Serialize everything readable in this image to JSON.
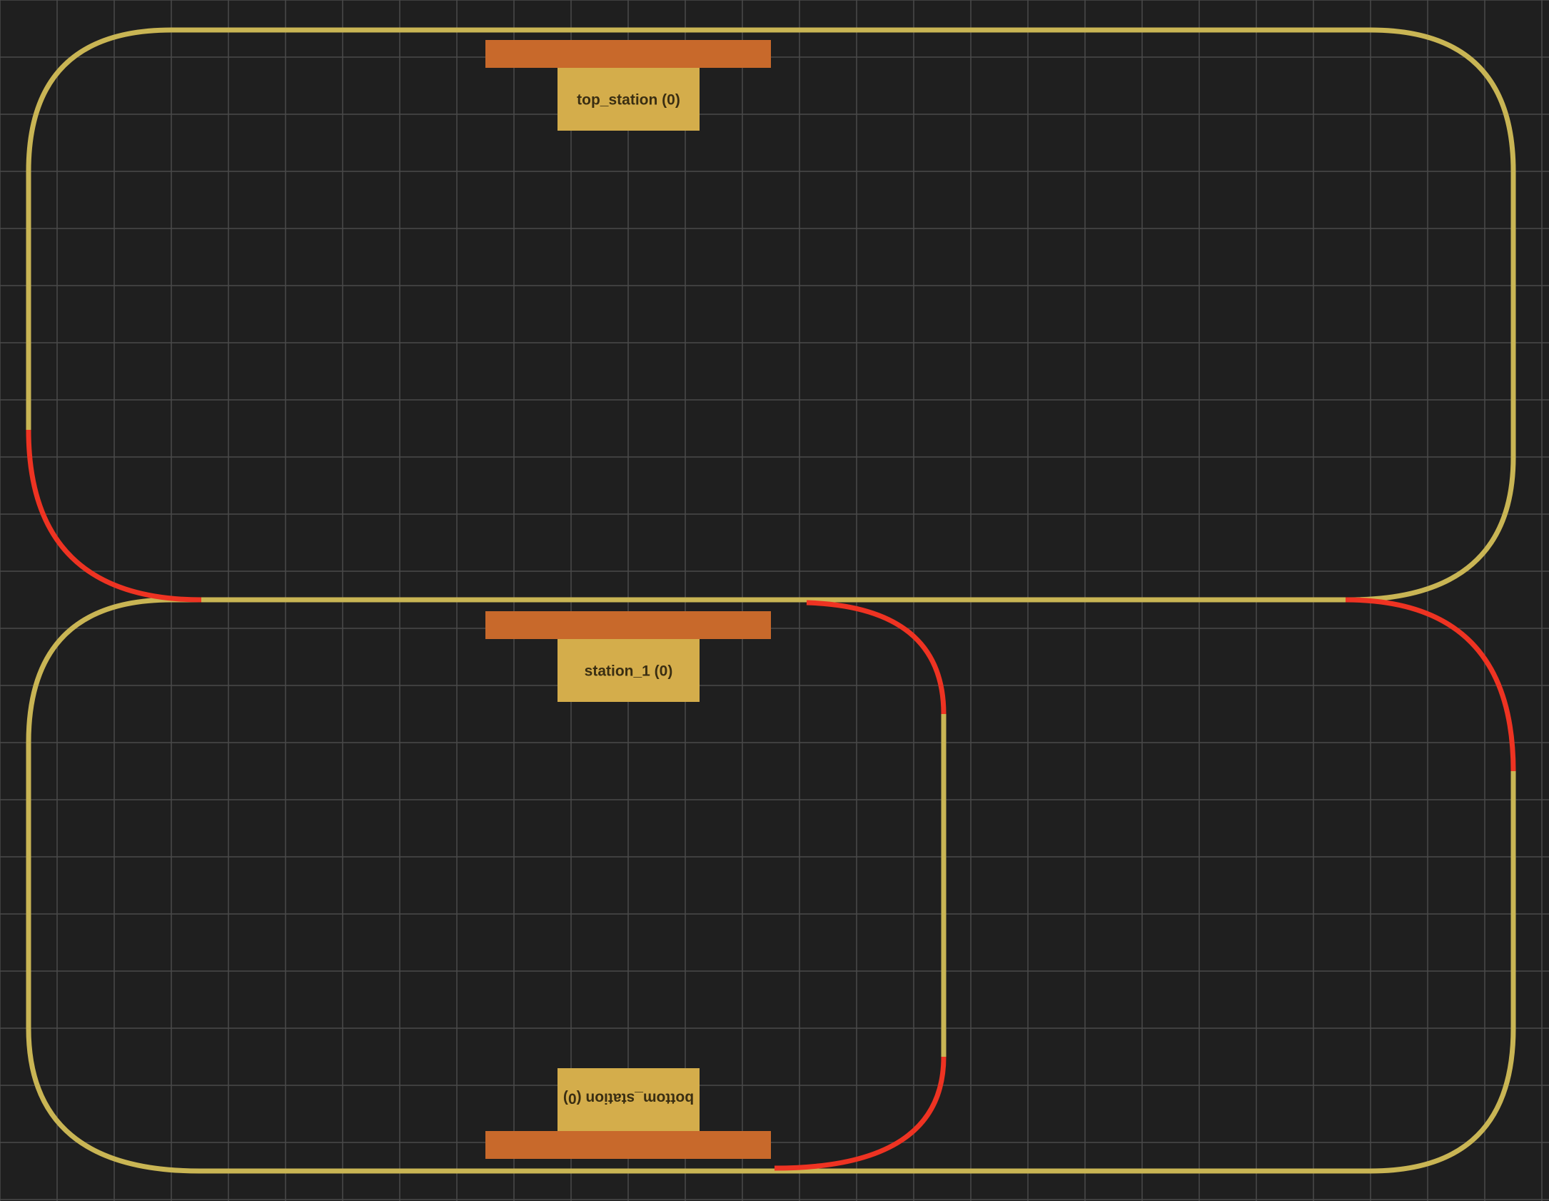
{
  "colors": {
    "background": "#1f1f1f",
    "grid": "#4a4a4a",
    "track": "#c9b554",
    "track_highlight": "#ee3322",
    "platform": "#c8692b",
    "station_body": "#d4ad4b",
    "label_text": "#3a2e12"
  },
  "stations": [
    {
      "id": "top_station",
      "label": "top_station (0)",
      "flipped": false
    },
    {
      "id": "station_1",
      "label": "station_1 (0)",
      "flipped": false
    },
    {
      "id": "bottom_station",
      "label": "bottom_station (0)",
      "flipped": true
    }
  ]
}
